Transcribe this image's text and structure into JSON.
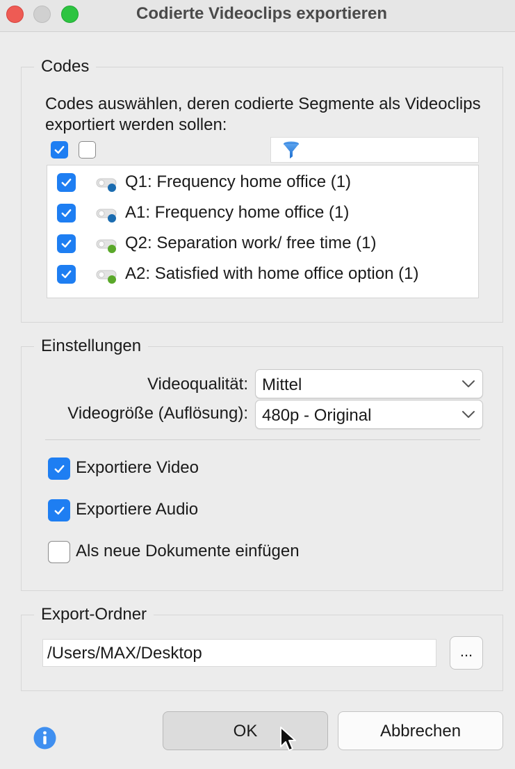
{
  "window": {
    "title": "Codierte Videoclips exportieren"
  },
  "codes": {
    "legend": "Codes",
    "description": "Codes auswählen, deren codierte Segmente als Videoclips exportiert werden sollen:",
    "filter_value": "",
    "items": [
      {
        "label": "Q1: Frequency home office (1)",
        "checked": true,
        "dot_color": "#1b6cb0"
      },
      {
        "label": "A1: Frequency home office (1)",
        "checked": true,
        "dot_color": "#1b6cb0"
      },
      {
        "label": "Q2: Separation work/ free time (1)",
        "checked": true,
        "dot_color": "#5aa82a"
      },
      {
        "label": "A2: Satisfied with home office option (1)",
        "checked": true,
        "dot_color": "#5aa82a"
      }
    ]
  },
  "settings": {
    "legend": "Einstellungen",
    "quality_label": "Videoqualität:",
    "quality_value": "Mittel",
    "size_label": "Videogröße (Auflösung):",
    "size_value": "480p - Original",
    "export_video_label": "Exportiere Video",
    "export_video_checked": true,
    "export_audio_label": "Exportiere Audio",
    "export_audio_checked": true,
    "insert_docs_label": "Als neue Dokumente einfügen",
    "insert_docs_checked": false
  },
  "export_folder": {
    "legend": "Export-Ordner",
    "path": "/Users/MAX/Desktop",
    "browse_label": "..."
  },
  "buttons": {
    "ok": "OK",
    "cancel": "Abbrechen"
  },
  "colors": {
    "accent": "#1e7ef2",
    "code_blue": "#1b6cb0",
    "code_green": "#5aa82a"
  }
}
